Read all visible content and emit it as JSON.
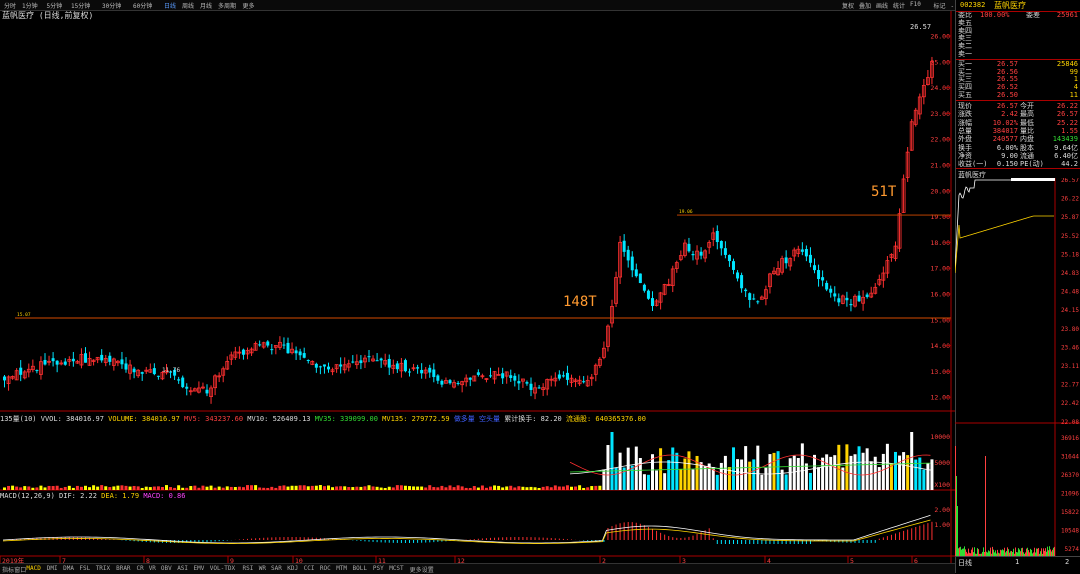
{
  "topbar": {
    "items": [
      "分时",
      "1分钟",
      "5分钟",
      "15分钟",
      "30分钟",
      "60分钟",
      "日线",
      "周线",
      "月线",
      "多周期",
      "更多"
    ],
    "active_index": 6,
    "right_items": [
      "复权",
      "叠加",
      "画线",
      "统计",
      "F10",
      "标记",
      "-自选",
      "返回"
    ]
  },
  "title": "蓝帆医疗 (日线,前复权)",
  "price_axis": [
    "26.00",
    "25.00",
    "24.00",
    "23.00",
    "22.00",
    "21.00",
    "20.00",
    "19.00",
    "18.00",
    "17.00",
    "16.00",
    "15.00",
    "14.00",
    "13.00",
    "12.00"
  ],
  "annotations": {
    "price_high": "26.57",
    "price_low": "11.76",
    "line1_tag": "15.07",
    "line2_tag": "19.06",
    "label_148t": "148T",
    "label_51t": "51T"
  },
  "volume_header": {
    "name": "135量(10)",
    "vvol": "VVOL: 384016.97",
    "volume": "VOLUME: 384016.97",
    "mv5": "MV5: 343237.60",
    "mv10": "MV10: 526409.13",
    "mv35": "MV35: 339099.00",
    "mv135": "MV135: 279772.59",
    "bull": "做多量",
    "bear": "空头量",
    "cum_turnover": "累计换手: 82.20",
    "float_shares": "流通股: 640365376.00"
  },
  "volume_axis": [
    "10000",
    "5000",
    "X100"
  ],
  "macd_header": {
    "name": "MACD(12,26,9)",
    "dif": "DIF: 2.22",
    "dea": "DEA: 1.79",
    "macd": "MACD: 0.86"
  },
  "macd_axis": [
    "2.00",
    "1.00"
  ],
  "x_axis": [
    "2019年",
    "7",
    "8",
    "9",
    "10",
    "11",
    "12",
    "2",
    "3",
    "4",
    "5",
    "6"
  ],
  "bottombar": {
    "items": [
      "指标",
      "窗口",
      "MACD",
      "DMI",
      "DMA",
      "FSL",
      "TRIX",
      "BRAR",
      "CR",
      "VR",
      "OBV",
      "ASI",
      "EMV",
      "VOL-TDX",
      "RSI",
      "WR",
      "SAR",
      "KDJ",
      "CCI",
      "ROC",
      "MTM",
      "BOLL",
      "PSY",
      "MCST",
      "更多",
      "设置"
    ],
    "active_index": 2
  },
  "side": {
    "code": "002382",
    "name": "蓝帆医疗",
    "wb_label": "委比",
    "wb_value": "100.00%",
    "wc_label": "委差",
    "wc_value": "25961",
    "sells": [
      {
        "label": "卖五",
        "price": "",
        "vol": ""
      },
      {
        "label": "卖四",
        "price": "",
        "vol": ""
      },
      {
        "label": "卖三",
        "price": "",
        "vol": ""
      },
      {
        "label": "卖二",
        "price": "",
        "vol": ""
      },
      {
        "label": "卖一",
        "price": "",
        "vol": ""
      }
    ],
    "buys": [
      {
        "label": "买一",
        "price": "26.57",
        "vol": "25846"
      },
      {
        "label": "买二",
        "price": "26.56",
        "vol": "99"
      },
      {
        "label": "买三",
        "price": "26.55",
        "vol": "1"
      },
      {
        "label": "买四",
        "price": "26.52",
        "vol": "4"
      },
      {
        "label": "买五",
        "price": "26.50",
        "vol": "11"
      }
    ],
    "quotes": [
      {
        "l1": "现价",
        "v1": "26.57",
        "l2": "今开",
        "v2": "26.22"
      },
      {
        "l1": "涨跌",
        "v1": "2.42",
        "l2": "最高",
        "v2": "26.57"
      },
      {
        "l1": "涨幅",
        "v1": "10.02%",
        "l2": "最低",
        "v2": "25.22"
      },
      {
        "l1": "总量",
        "v1": "384017",
        "l2": "量比",
        "v2": "1.55"
      },
      {
        "l1": "外盘",
        "v1": "240577",
        "l2": "内盘",
        "v2": "143439"
      },
      {
        "l1": "换手",
        "v1": "6.00%",
        "l2": "股本",
        "v2": "9.64亿"
      },
      {
        "l1": "净资",
        "v1": "9.00",
        "l2": "流通",
        "v2": "6.40亿"
      },
      {
        "l1": "收益(一)",
        "v1": "0.150",
        "l2": "PE(动)",
        "v2": "44.2"
      }
    ],
    "mini_title": "蓝帆医疗",
    "mini_axis": [
      "26.57",
      "26.22",
      "25.87",
      "25.52",
      "25.18",
      "24.83",
      "24.48",
      "24.15",
      "23.80",
      "23.46",
      "23.11",
      "22.77",
      "22.42",
      "22.08",
      "36916",
      "31644",
      "26370",
      "21096",
      "15822",
      "10548",
      "5274"
    ],
    "bottom": [
      "日线",
      "1",
      "2"
    ]
  },
  "colors": {
    "up": "#ff3030",
    "down": "#00e5ff",
    "line": "#d44a00",
    "mv5": "#ffffff",
    "mv10": "#ffd400",
    "mv35": "#33dd33"
  }
}
